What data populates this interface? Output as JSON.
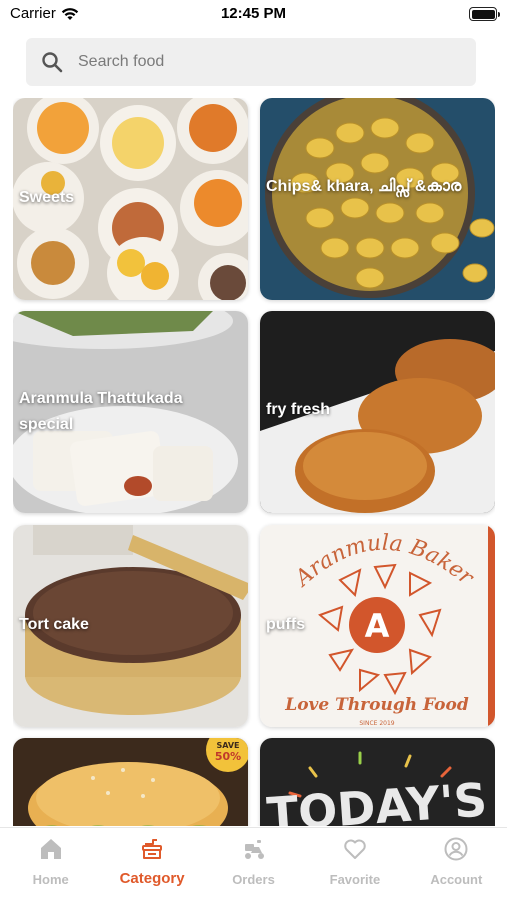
{
  "status_bar": {
    "carrier": "Carrier",
    "time": "12:45 PM",
    "battery_level": 1.0
  },
  "search": {
    "placeholder": "Search food",
    "value": ""
  },
  "categories": [
    {
      "label": "Sweets"
    },
    {
      "label": "Chips& khara, ചിപ്സ് &കാര"
    },
    {
      "label": "Aranmula Thattukada special"
    },
    {
      "label": "fry fresh"
    },
    {
      "label": "Tort cake"
    },
    {
      "label": "puffs",
      "image_text": {
        "brand": "Aranmula Bakers",
        "tagline": "Love Through Food",
        "since": "SINCE 2019"
      }
    },
    {
      "label": "",
      "image_text": {
        "badge_top": "SAVE",
        "badge_value": "50%"
      }
    },
    {
      "label": "",
      "image_text": {
        "headline": "TODAY'S"
      }
    }
  ],
  "tabbar": {
    "items": [
      {
        "label": "Home",
        "icon": "home-icon"
      },
      {
        "label": "Category",
        "icon": "category-icon"
      },
      {
        "label": "Orders",
        "icon": "orders-icon"
      },
      {
        "label": "Favorite",
        "icon": "heart-icon"
      },
      {
        "label": "Account",
        "icon": "account-icon"
      }
    ],
    "active_index": 1,
    "active_color": "#e05a2b",
    "inactive_color": "#bdbdbd"
  }
}
